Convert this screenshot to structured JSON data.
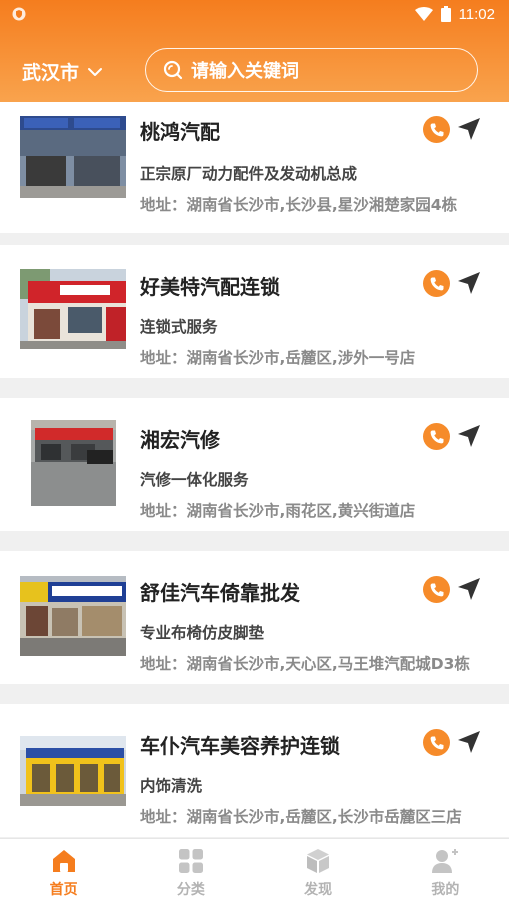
{
  "statusbar": {
    "time": "11:02"
  },
  "header": {
    "city": "武汉市",
    "search_placeholder": "请输入关键词"
  },
  "shops": [
    {
      "name": "桃鸿汽配",
      "desc": "正宗原厂动力配件及发动机总成",
      "address": "地址：湖南省长沙市,长沙县,星沙湘楚家园4栋",
      "image": "storefront-blue-sign-photo"
    },
    {
      "name": "好美特汽配连锁",
      "desc": "连锁式服务",
      "address": "地址：湖南省长沙市,岳麓区,涉外一号店",
      "image": "storefront-red-sign-photo"
    },
    {
      "name": "湘宏汽修",
      "desc": "汽修一体化服务",
      "address": "地址：湖南省长沙市,雨花区,黄兴街道店",
      "image": "repair-shop-photo"
    },
    {
      "name": "舒佳汽车倚靠批发",
      "desc": "专业布椅仿皮脚垫",
      "address": "地址：湖南省长沙市,天心区,马王堆汽配城D3栋",
      "image": "wholesale-shop-photo"
    },
    {
      "name": "车仆汽车美容养护连锁",
      "desc": "内饰清洗",
      "address": "地址：湖南省长沙市,岳麓区,长沙市岳麓区三店",
      "image": "yellow-garage-photo"
    }
  ],
  "bottom_nav": [
    {
      "label": "首页",
      "icon": "home-icon",
      "active": true
    },
    {
      "label": "分类",
      "icon": "grid-icon",
      "active": false
    },
    {
      "label": "发现",
      "icon": "cube-icon",
      "active": false
    },
    {
      "label": "我的",
      "icon": "user-add-icon",
      "active": false
    }
  ],
  "colors": {
    "accent": "#f57d1e",
    "call": "#f68b2a"
  }
}
